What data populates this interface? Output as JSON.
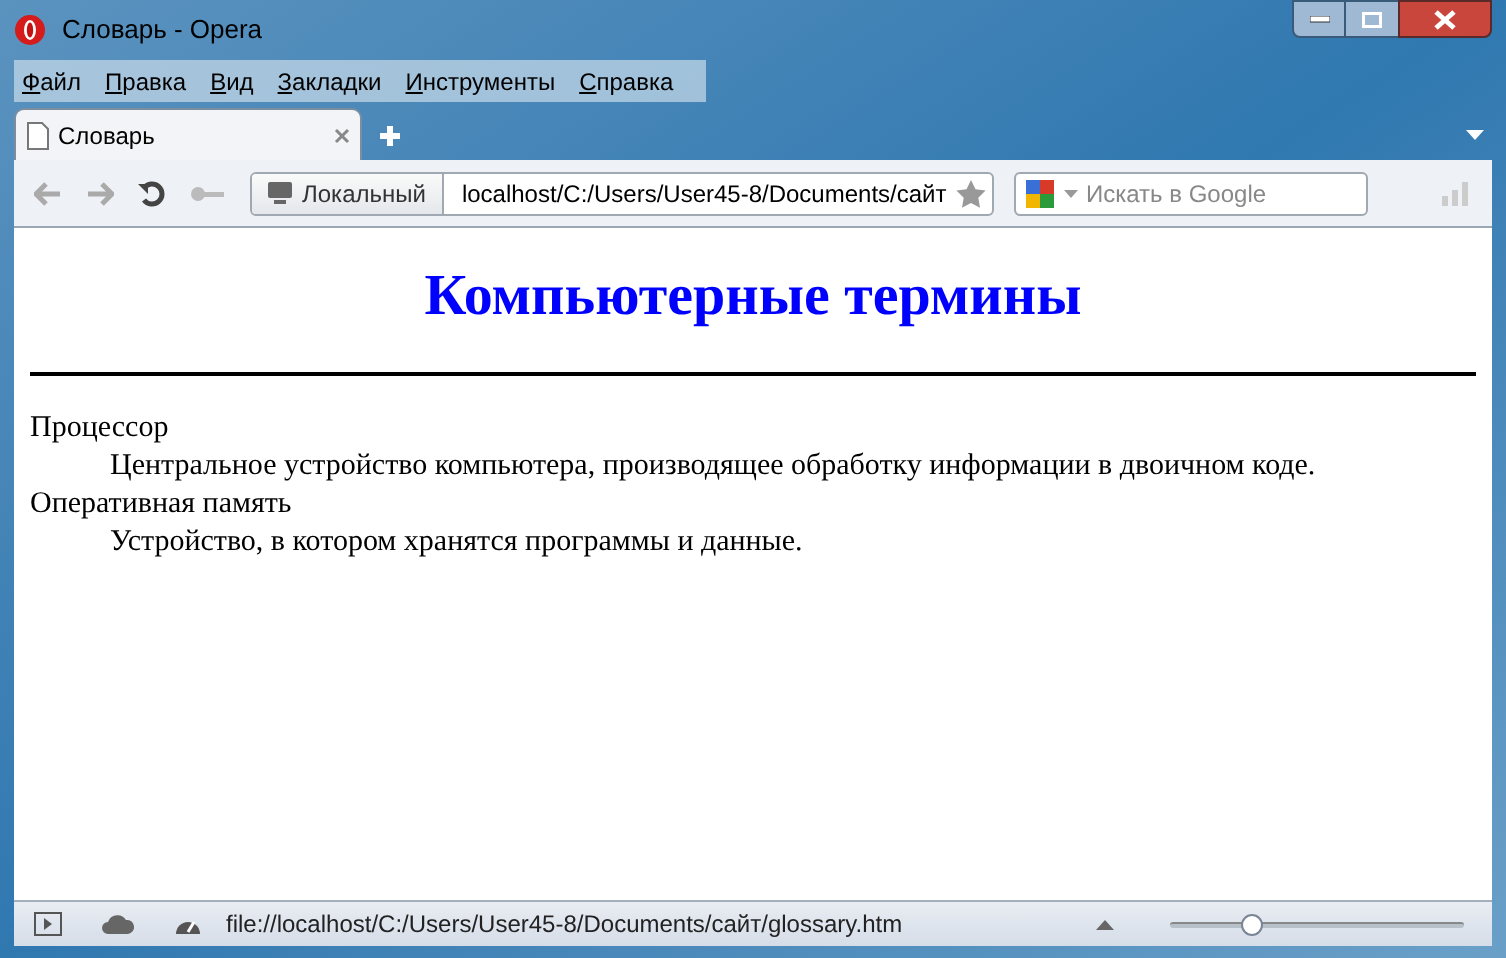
{
  "window": {
    "title": "Словарь - Opera"
  },
  "menu": [
    "Файл",
    "Правка",
    "Вид",
    "Закладки",
    "Инструменты",
    "Справка"
  ],
  "tabs": [
    {
      "label": "Словарь",
      "selected": true
    }
  ],
  "toolbar": {
    "security_label": "Локальный",
    "address": "localhost/C:/Users/User45-8/Documents/сайт",
    "search_placeholder": "Искать в Google"
  },
  "page": {
    "heading": "Компьютерные термины",
    "terms": [
      {
        "term": "Процессор",
        "definition": "Центральное устройство компьютера, производящее обработку информации в двоичном коде."
      },
      {
        "term": "Оперативная память",
        "definition": "Устройство, в котором хранятся программы и данные."
      }
    ]
  },
  "status_bar": {
    "url": "file://localhost/C:/Users/User45-8/Documents/сайт/glossary.htm",
    "zoom": {
      "level": 0.28
    }
  }
}
